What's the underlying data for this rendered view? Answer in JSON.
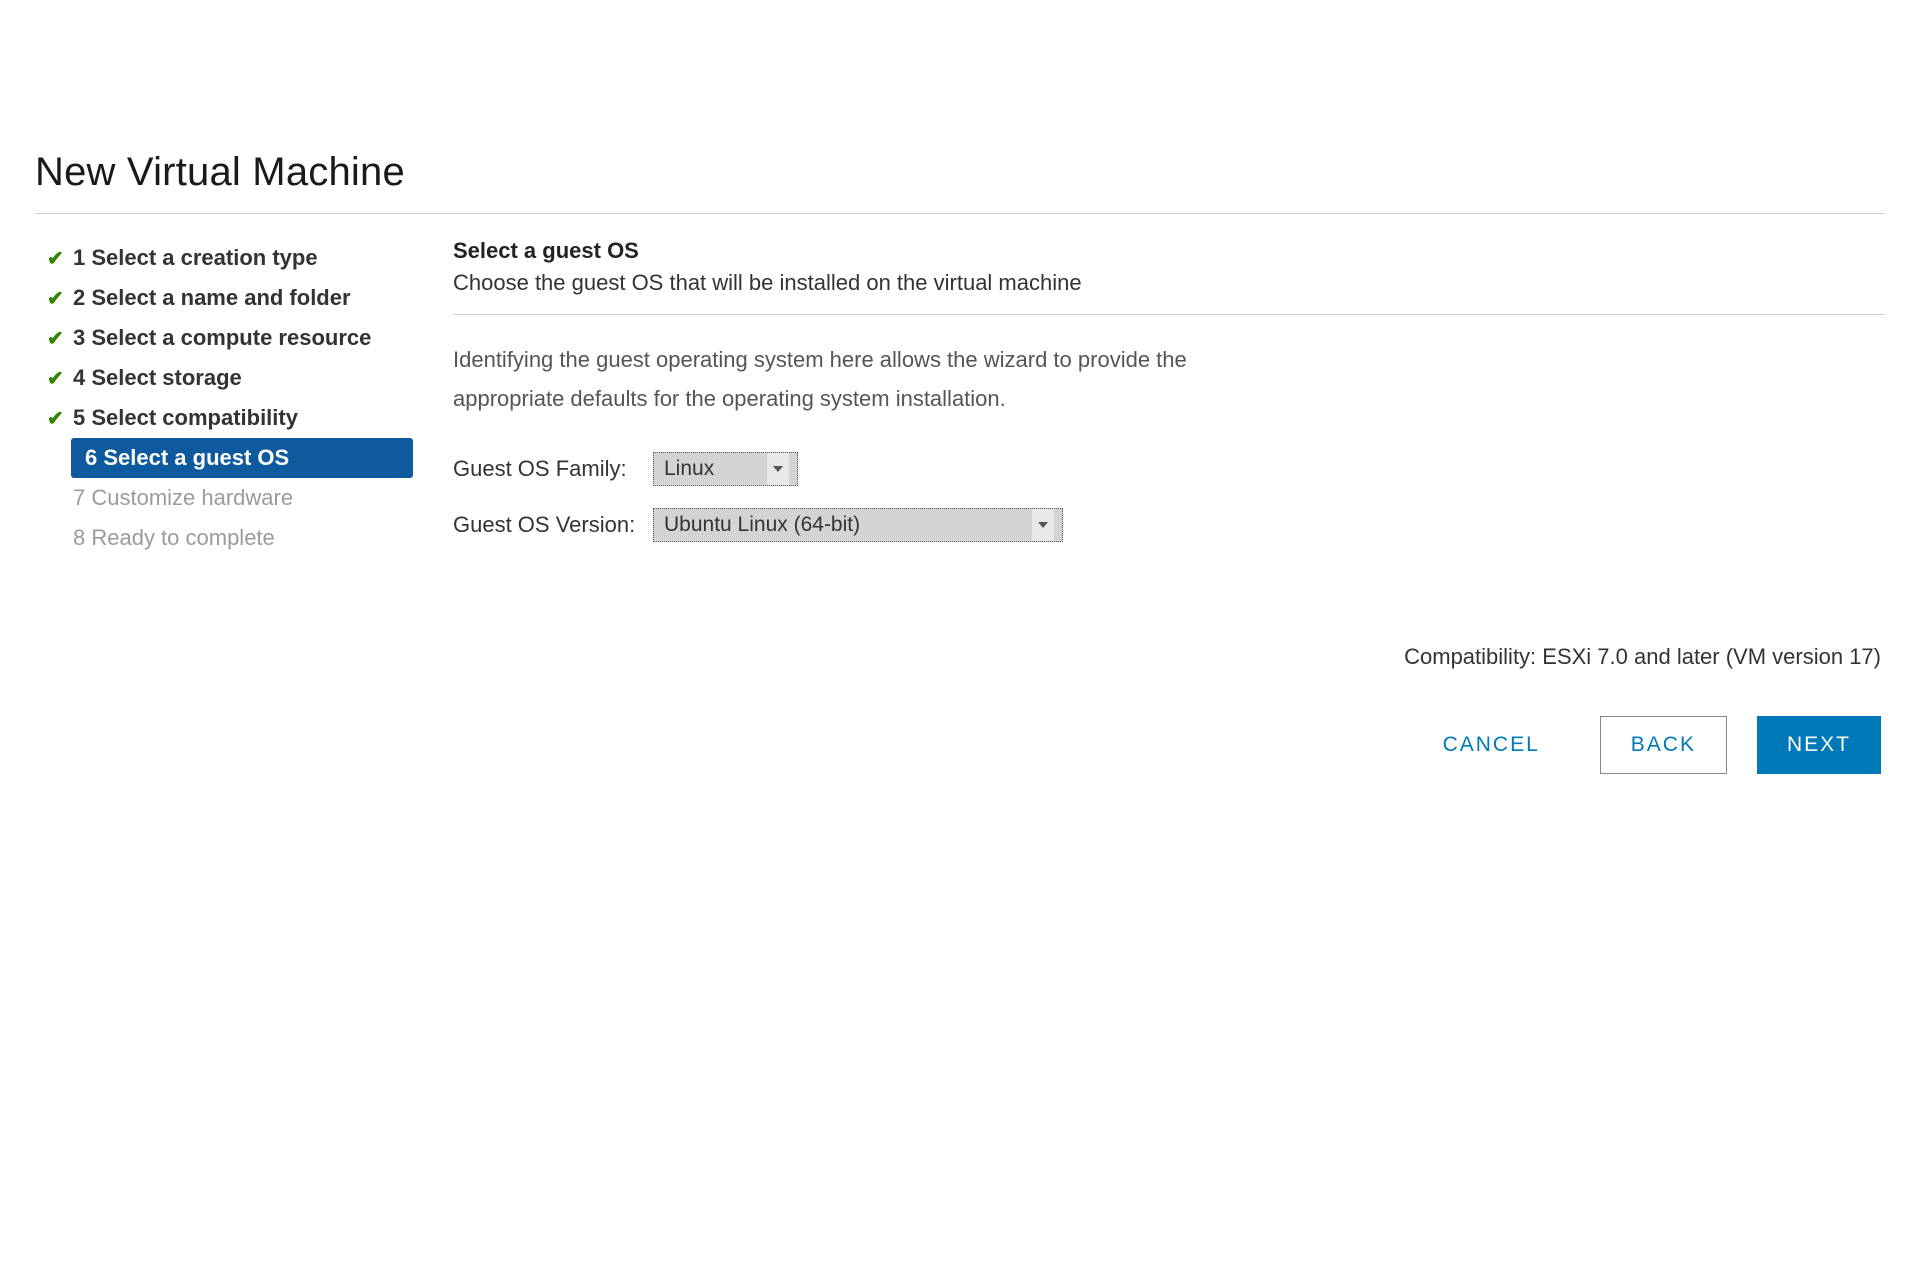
{
  "title": "New Virtual Machine",
  "steps": [
    {
      "label": "1 Select a creation type",
      "state": "done"
    },
    {
      "label": "2 Select a name and folder",
      "state": "done"
    },
    {
      "label": "3 Select a compute resource",
      "state": "done"
    },
    {
      "label": "4 Select storage",
      "state": "done"
    },
    {
      "label": "5 Select compatibility",
      "state": "done"
    },
    {
      "label": "6 Select a guest OS",
      "state": "active"
    },
    {
      "label": "7 Customize hardware",
      "state": "future"
    },
    {
      "label": "8 Ready to complete",
      "state": "future"
    }
  ],
  "content": {
    "heading": "Select a guest OS",
    "subheading": "Choose the guest OS that will be installed on the virtual machine",
    "description": "Identifying the guest operating system here allows the wizard to provide the appropriate defaults for the operating system installation.",
    "family_label": "Guest OS Family:",
    "family_value": "Linux",
    "version_label": "Guest OS Version:",
    "version_value": "Ubuntu Linux (64-bit)",
    "compatibility": "Compatibility: ESXi 7.0 and later (VM version 17)"
  },
  "buttons": {
    "cancel": "CANCEL",
    "back": "BACK",
    "next": "NEXT"
  }
}
